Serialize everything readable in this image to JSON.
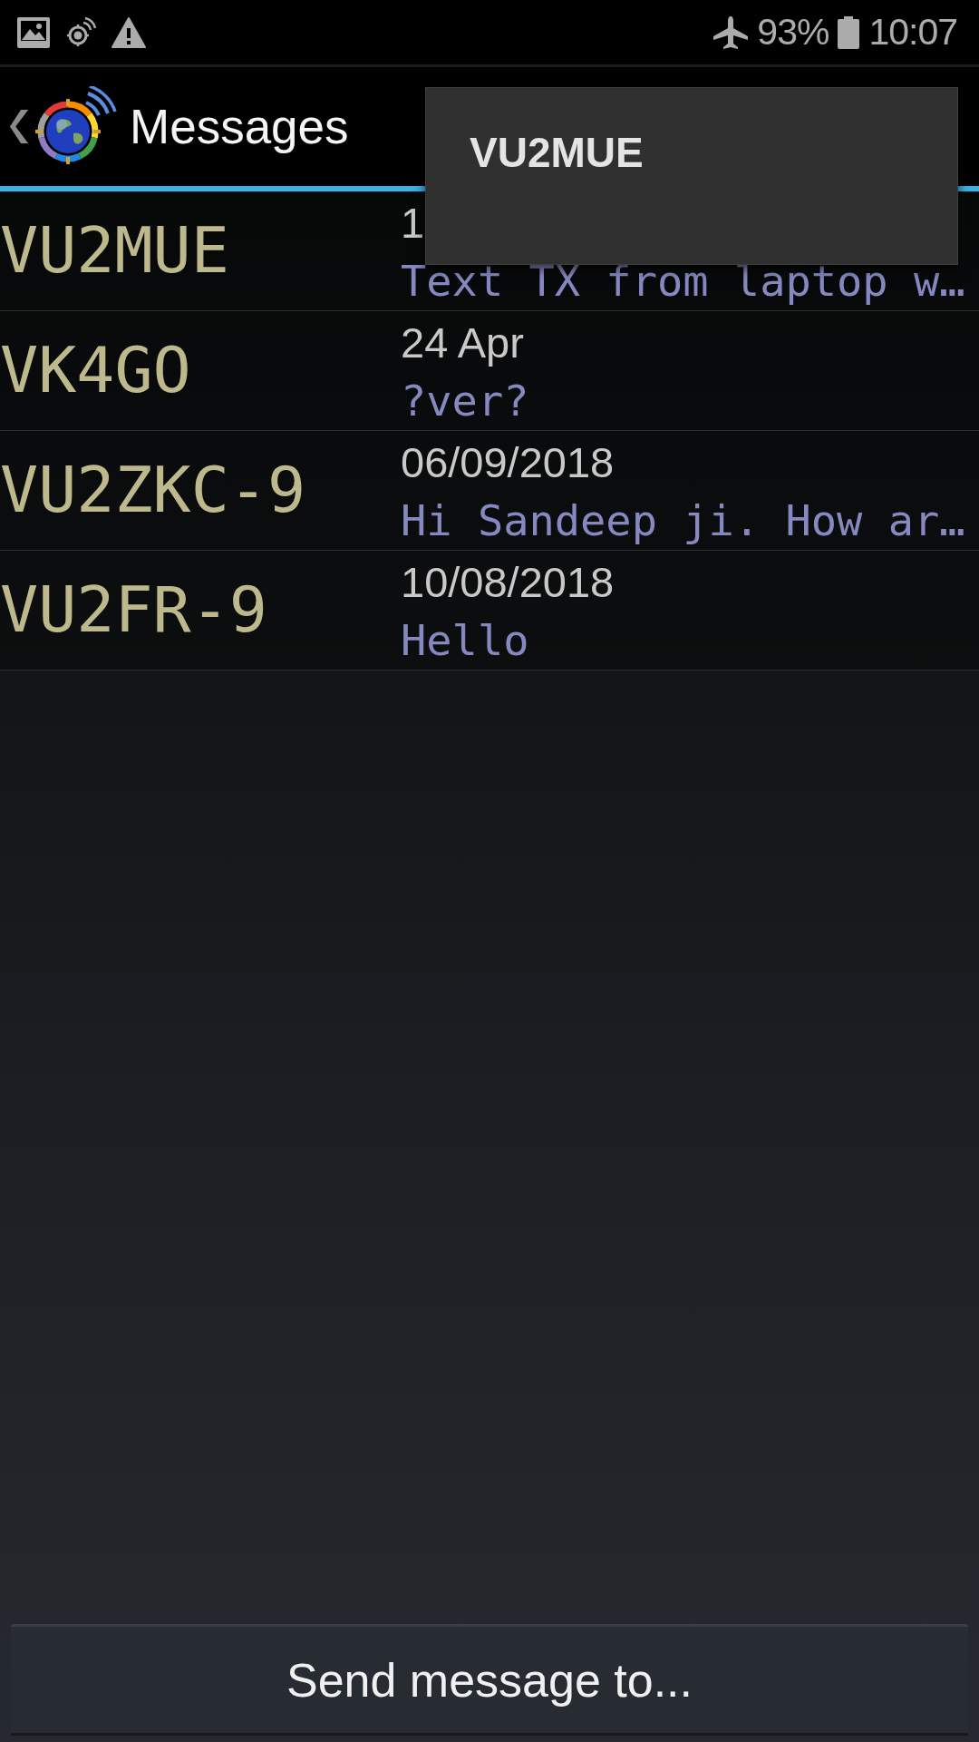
{
  "status_bar": {
    "battery": "93%",
    "time": "10:07"
  },
  "action_bar": {
    "title": "Messages"
  },
  "messages": [
    {
      "callsign": "VU2MUE",
      "date": "1",
      "preview": "Text TX from laptop w…"
    },
    {
      "callsign": "VK4GO",
      "date": "24 Apr",
      "preview": "?ver?"
    },
    {
      "callsign": "VU2ZKC-9",
      "date": "06/09/2018",
      "preview": "Hi Sandeep ji. How ar…"
    },
    {
      "callsign": "VU2FR-9",
      "date": "10/08/2018",
      "preview": "Hello"
    }
  ],
  "popup": {
    "items": [
      "VU2MUE"
    ]
  },
  "send_button": {
    "label": "Send message to..."
  }
}
